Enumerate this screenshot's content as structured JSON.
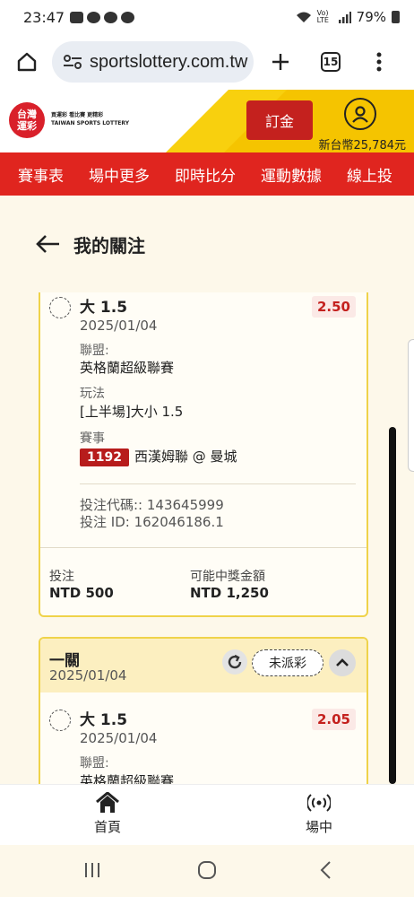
{
  "status_bar": {
    "time": "23:47",
    "signal_text": "Vo) LTE",
    "battery": "79%"
  },
  "browser": {
    "url": "sportslottery.com.tw",
    "tab_count": "15"
  },
  "site": {
    "logo_text": "台灣運彩",
    "tagline_lines": [
      "買運彩  看比賽  更精彩",
      "TAIWAN SPORTS LOTTERY"
    ],
    "order_label": "訂金",
    "balance": "新台幣25,784元"
  },
  "nav": {
    "items": [
      "賽事表",
      "場中更多",
      "即時比分",
      "運動數據",
      "線上投"
    ]
  },
  "page": {
    "title": "我的關注"
  },
  "card1": {
    "bet_name": "大 1.5",
    "bet_date": "2025/01/04",
    "odds": "2.50",
    "league_label": "聯盟:",
    "league_value": "英格蘭超級聯賽",
    "play_label": "玩法",
    "play_value": "[上半場]大小 1.5",
    "event_label": "賽事",
    "event_code": "1192",
    "event_teams": "西漢姆聯 @ 曼城",
    "bet_code": "投注代碼:: 143645999",
    "bet_id": "投注 ID: 162046186.1",
    "stake_label": "投注",
    "stake_value": "NTD 500",
    "payout_label": "可能中獎金額",
    "payout_value": "NTD 1,250"
  },
  "card2": {
    "title": "一關",
    "date": "2025/01/04",
    "status": "未派彩",
    "bet_name": "大 1.5",
    "bet_date": "2025/01/04",
    "odds": "2.05",
    "league_label": "聯盟:",
    "league_value": "英格蘭超級聯賽"
  },
  "bottom_nav": {
    "home": "首頁",
    "live": "場中"
  },
  "colors": {
    "brand_red": "#e0251f",
    "brand_yellow": "#f8d00e",
    "odds_red": "#c4211e"
  }
}
